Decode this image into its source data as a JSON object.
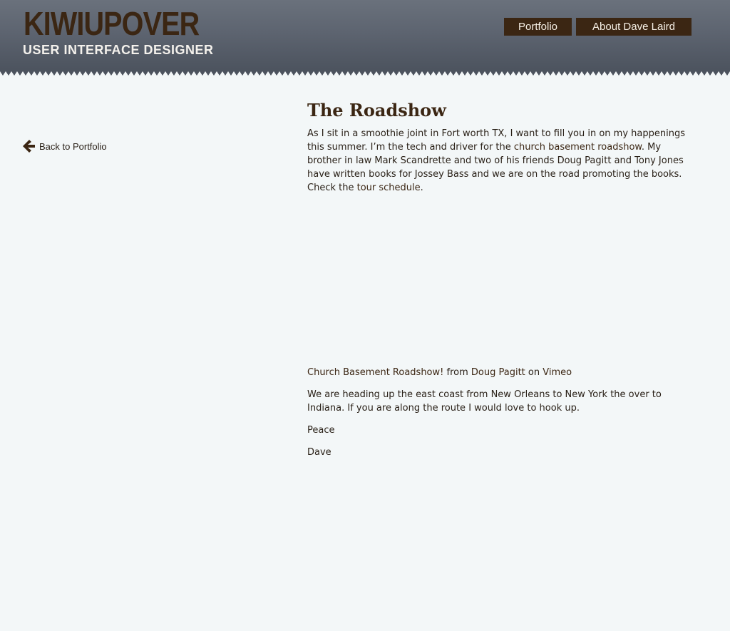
{
  "header": {
    "logo": "KIWIUPOVER",
    "tagline": "USER INTERFACE DESIGNER",
    "nav": {
      "portfolio": "Portfolio",
      "about": "About Dave Laird"
    }
  },
  "sidebar": {
    "back_label": "Back to Portfolio",
    "back_icon": "arrow-left-icon"
  },
  "post": {
    "title": "The Roadshow",
    "intro": {
      "part1": "As I sit in a smoothie joint in Fort worth TX, I want to fill you in on my happenings this summer. I’m the tech and driver for the ",
      "link1": "church basement roadshow",
      "part2": ". My brother in law Mark Scandrette and two of his friends Doug Pagitt and Tony Jones have written books for Jossey Bass and we are on the road promoting the books. Check the ",
      "link2": "tour schedule",
      "part3": "."
    },
    "vimeo": {
      "video_title": "Church Basement Roadshow!",
      "from": " from ",
      "author": "Doug Pagitt",
      "on": " on ",
      "site": "Vimeo"
    },
    "body": "We are heading up the east coast from New Orleans to New York the over to Indiana. If you are along the route I would love to hook up.",
    "signoff": "Peace",
    "signature": "Dave"
  },
  "colors": {
    "brand_brown": "#3b2613",
    "header_gray": "#5d6470",
    "page_bg": "#f3f7f8",
    "nav_text": "#f6f0e6"
  }
}
